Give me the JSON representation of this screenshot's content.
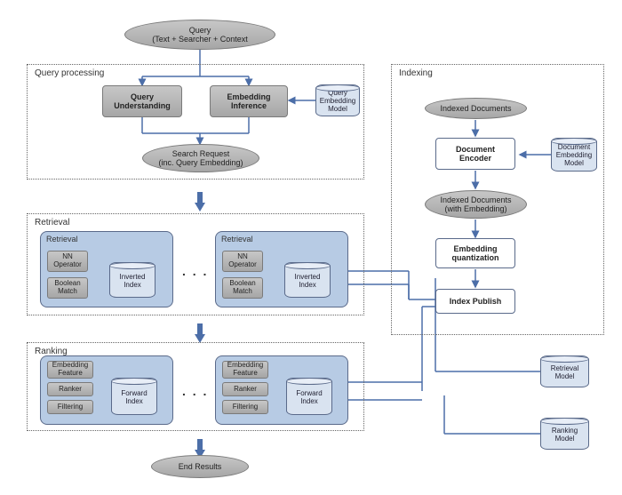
{
  "title_block": {
    "query": "Query\n(Text + Searcher + Context"
  },
  "sections": {
    "query_processing": "Query processing",
    "retrieval": "Retrieval",
    "ranking": "Ranking",
    "indexing": "Indexing"
  },
  "qp": {
    "query_understanding": "Query\nUnderstanding",
    "embedding_inference": "Embedding\nInference",
    "query_embed_model": "Query\nEmbedding\nModel",
    "search_request": "Search Request\n(inc. Query Embedding)"
  },
  "retrieval_panel": {
    "label": "Retrieval",
    "nn_operator": "NN\nOperator",
    "boolean_match": "Boolean\nMatch",
    "inverted_index": "Inverted\nIndex"
  },
  "ranking_panel": {
    "embedding_feature": "Embedding\nFeature",
    "ranker": "Ranker",
    "filtering": "Filtering",
    "forward_index": "Forward\nIndex"
  },
  "indexing_col": {
    "indexed_documents": "Indexed Documents",
    "document_encoder": "Document\nEncoder",
    "doc_embed_model": "Document\nEmbedding\nModel",
    "indexed_docs_embed": "Indexed Documents\n(with Embedding)",
    "embedding_quant": "Embedding\nquantization",
    "index_publish": "Index Publish"
  },
  "right_models": {
    "retrieval_model": "Retrieval\nModel",
    "ranking_model": "Ranking\nModel"
  },
  "end_results": "End Results",
  "ellipsis": ". . ."
}
